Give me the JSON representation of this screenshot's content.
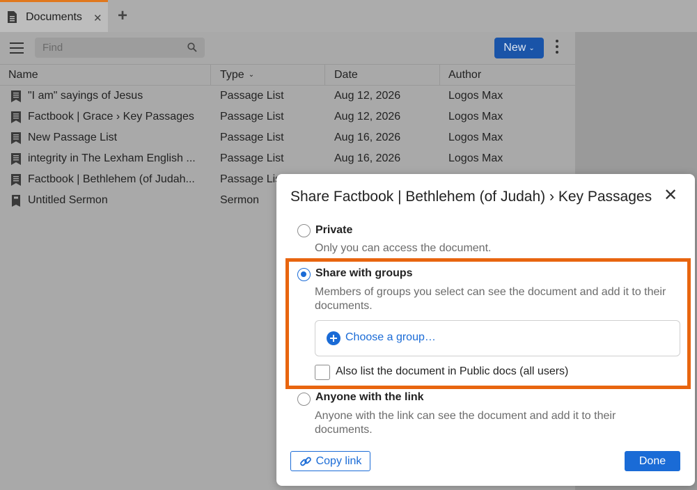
{
  "tabbar": {
    "tab_label": "Documents",
    "close_glyph": "✕",
    "add_glyph": "+"
  },
  "toolbar": {
    "find_placeholder": "Find",
    "new_label": "New",
    "new_chevron": "⌄"
  },
  "table": {
    "headers": [
      "Name",
      "Type",
      "Date",
      "Author"
    ],
    "sort_indicator": "⌄",
    "rows": [
      {
        "name": "\"I am\" sayings of Jesus",
        "type": "Passage List",
        "date": "Aug 12, 2026",
        "author": "Logos Max",
        "icon": "passage-list-icon"
      },
      {
        "name": "Factbook | Grace › Key Passages",
        "type": "Passage List",
        "date": "Aug 12, 2026",
        "author": "Logos Max",
        "icon": "passage-list-icon"
      },
      {
        "name": "New Passage List",
        "type": "Passage List",
        "date": "Aug 16, 2026",
        "author": "Logos Max",
        "icon": "passage-list-icon"
      },
      {
        "name": "integrity in The Lexham English ...",
        "type": "Passage List",
        "date": "Aug 16, 2026",
        "author": "Logos Max",
        "icon": "passage-list-icon"
      },
      {
        "name": "Factbook | Bethlehem (of Judah...",
        "type": "Passage List",
        "date": "",
        "author": "",
        "icon": "passage-list-icon"
      },
      {
        "name": "Untitled Sermon",
        "type": "Sermon",
        "date": "",
        "author": "",
        "icon": "sermon-icon"
      }
    ]
  },
  "dialog": {
    "title": "Share Factbook | Bethlehem (of Judah) › Key Passages",
    "close_glyph": "✕",
    "options": [
      {
        "label": "Private",
        "description": "Only you can access the document.",
        "checked": false
      },
      {
        "label": "Share with groups",
        "description": "Members of groups you select can see the document and add it to their documents.",
        "checked": true
      },
      {
        "label": "Anyone with the link",
        "description": "Anyone with the link can see the document and add it to their documents.",
        "checked": false
      }
    ],
    "choose_group_label": "Choose a group…",
    "public_docs_label": "Also list the document in Public docs (all users)",
    "public_docs_checked": false,
    "copy_link_label": "Copy link",
    "done_label": "Done"
  },
  "colors": {
    "accent": "#1a6bd6",
    "highlight": "#e8650f",
    "tab_accent": "#e0781e"
  }
}
